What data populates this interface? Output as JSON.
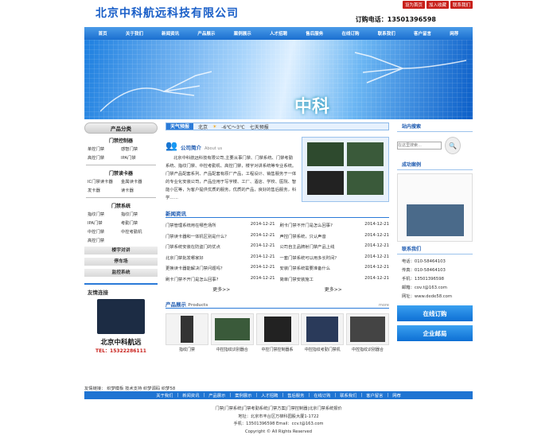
{
  "header": {
    "company": "北京中科航远科技有限公司",
    "top_links": [
      "设为首页",
      "加入收藏",
      "联系我们"
    ],
    "phone": "订购电话：13501396598"
  },
  "nav": [
    "首页",
    "关于我们",
    "新闻资讯",
    "产品展示",
    "案例展示",
    "人才招聘",
    "售后服务",
    "在线订购",
    "联系我们",
    "客户留言",
    "网荐"
  ],
  "banner": {
    "text": "中科"
  },
  "left": {
    "title": "产品分类",
    "sections": [
      {
        "title": "门禁控制器",
        "items": [
          "单控门禁",
          "感智门禁",
          "高控门禁",
          "IPA门禁"
        ]
      },
      {
        "title": "门禁读卡器",
        "items": [
          "IC门禁读卡器",
          "金属读卡器",
          "发卡器",
          "读卡器"
        ]
      },
      {
        "title": "门禁系统",
        "items": [
          "指纹门禁",
          "指纹门禁",
          "IPA门禁",
          "考勤门禁",
          "中控门禁",
          "中控考勤机",
          "高控门禁"
        ]
      }
    ],
    "bars": [
      "楼宇对讲",
      "停车场",
      "监控系统"
    ],
    "contact": {
      "title": "友情连接",
      "company": "北京中科航远",
      "tel": "TEL：15322286111"
    }
  },
  "weather": {
    "label": "天气预报",
    "city": "北京",
    "temp": "-6℃～3℃",
    "desc": "七天预报"
  },
  "about": {
    "title": "公司简介",
    "sub": "About us",
    "text": "北京中科航远科技有限公司,主要从事门禁、门禁系统、门禁考勤系统、指纹门禁、中控考勤机、高控门禁，楼宇对讲系统等专业系统。门禁产品配套系列、产品配套有原厂产品，工程设计、销售服务于一体的专业化安装公司，产品应用于写字楼、工厂、酒店、学校、医院、智能小区等，为客户提供优质的服务，优质的产品，良好的售后服务，科学……"
  },
  "news": {
    "title": "新闻资讯",
    "more": "更多>>",
    "items": [
      {
        "t": "门禁管理系统用在哪些场所",
        "d": "2014-12-21"
      },
      {
        "t": "刷卡门禁不开门是怎么回事?",
        "d": "2014-12-21"
      },
      {
        "t": "门禁读卡器和一体机区别是什么？",
        "d": "2014-12-21"
      },
      {
        "t": "声控门禁系统，只认声音",
        "d": "2014-12-21"
      },
      {
        "t": "门禁系统安装在防盗门的优点",
        "d": "2014-12-21"
      },
      {
        "t": "公司自主品牌射门禁产品上线",
        "d": "2014-12-21"
      },
      {
        "t": "北京门禁批发哪家好",
        "d": "2014-12-21"
      },
      {
        "t": "一套门禁系统可以用多长时间？",
        "d": "2014-12-21"
      },
      {
        "t": "更换读卡器能解决门禁问题吗？",
        "d": "2014-12-21"
      },
      {
        "t": "安装门禁系统需要准备什么",
        "d": "2014-12-21"
      },
      {
        "t": "刷卡门禁不开门是怎么回事?",
        "d": "2014-12-21"
      },
      {
        "t": "简单门禁安装施工",
        "d": "2014-12-21"
      }
    ]
  },
  "products": {
    "title": "产品展示",
    "sub": "Products",
    "more": "more",
    "items": [
      "指纹门禁",
      "中控指纹识别器合",
      "中控门禁控制器系",
      "中控指纹考勤门禁机",
      "中控指纹识别器合"
    ]
  },
  "right": {
    "search_title": "站内搜索",
    "search_placeholder": "在这里搜索…",
    "case_title": "成功案例",
    "contact_title": "联系我们",
    "contacts": [
      "电话：010-58464103",
      "传真：010-58464103",
      "手机：13501396598",
      "邮箱：cov.t@163.com",
      "网址：www.dede58.com"
    ],
    "btn1": "在线订购",
    "btn2": "企业邮局"
  },
  "friends": {
    "label": "友情链接：",
    "items": [
      "织梦模板",
      "技术支持",
      "织梦源码",
      "织梦58"
    ]
  },
  "footer_nav": [
    "关于我们",
    "新闻资讯",
    "产品展示",
    "案例展示",
    "人才招聘",
    "售后服务",
    "在线订购",
    "联系我们",
    "客户留言",
    "网荐"
  ],
  "footer": [
    "门禁|门禁系统|门禁考勤系统|门禁方案|门禁控制器|北京门禁系统报价",
    "地址：北京市丰台区万柳科园股大厦1-1722",
    "手机：13501396598 Email：ccv.t@163.com",
    "Copyright © All Rights Reserved"
  ]
}
